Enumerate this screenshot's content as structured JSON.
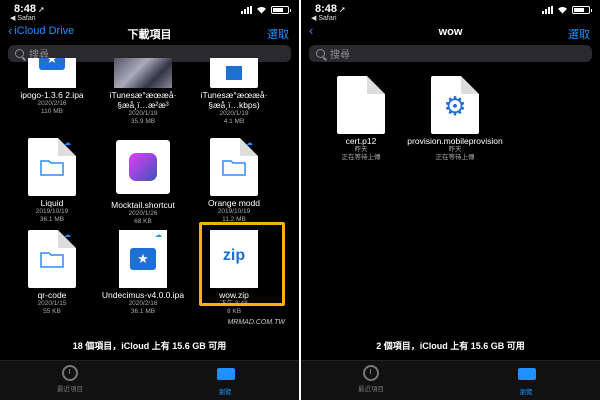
{
  "left": {
    "status": {
      "time": "8:48",
      "back_app": "◀ Safari"
    },
    "nav": {
      "back_label": "iCloud Drive",
      "title": "下載項目",
      "action": "選取"
    },
    "search": {
      "placeholder": "搜尋"
    },
    "items": [
      {
        "name": "ipogo-1.3.6 2.ipa",
        "date": "2020/2/16",
        "size": "110 MB",
        "icon": "star-app-icon"
      },
      {
        "name": "iTunesæ°æœæå· §æå¸ï…æ²æ³",
        "date": "2020/1/19",
        "size": "35.9 MB",
        "icon": "photo-thumbnail"
      },
      {
        "name": "iTunesæ°æœæå· §æå¸ï…kbps)",
        "date": "2020/1/19",
        "size": "4.1 MB",
        "icon": "audio-file-icon"
      },
      {
        "name": "Liquid",
        "date": "2019/10/19",
        "size": "36.1 MB",
        "icon": "folder-icon"
      },
      {
        "name": "Mocktail.shortcut",
        "date": "2020/1/26",
        "size": "68 KB",
        "icon": "shortcuts-icon"
      },
      {
        "name": "Orange modd",
        "date": "2019/10/19",
        "size": "11.2 MB",
        "icon": "folder-icon"
      },
      {
        "name": "qr-code",
        "date": "2020/1/15",
        "size": "55 KB",
        "icon": "folder-icon"
      },
      {
        "name": "Undecimus-v4.0.0.ipa",
        "date": "2020/2/16",
        "size": "36.1 MB",
        "icon": "star-app-icon"
      },
      {
        "name": "wow.zip",
        "date": "下午 8:48",
        "size": "8 KB",
        "icon": "zip-file-icon"
      }
    ],
    "zip_text": "zip",
    "footer": "18 個項目，iCloud 上有 15.6 GB 可用",
    "watermark": "MRMAD.COM.TW"
  },
  "right": {
    "status": {
      "time": "8:48",
      "back_app": "◀ Safari"
    },
    "nav": {
      "back_label": "",
      "title": "wow",
      "action": "選取"
    },
    "search": {
      "placeholder": "搜尋"
    },
    "items": [
      {
        "name": "cert.p12",
        "date": "昨天",
        "size": "正在等待上傳",
        "icon": "blank-file-icon"
      },
      {
        "name": "provision.mobileprovision",
        "date": "昨天",
        "size": "正在等待上傳",
        "icon": "gear-icon"
      }
    ],
    "footer": "2 個項目，iCloud 上有 15.6 GB 可用"
  },
  "tabs": [
    {
      "label": "最近項目",
      "icon": "clock-icon",
      "active": false
    },
    {
      "label": "瀏覽",
      "icon": "folder-icon",
      "active": true
    }
  ],
  "colors": {
    "accent": "#1e90ff",
    "highlight": "#f5b400"
  }
}
